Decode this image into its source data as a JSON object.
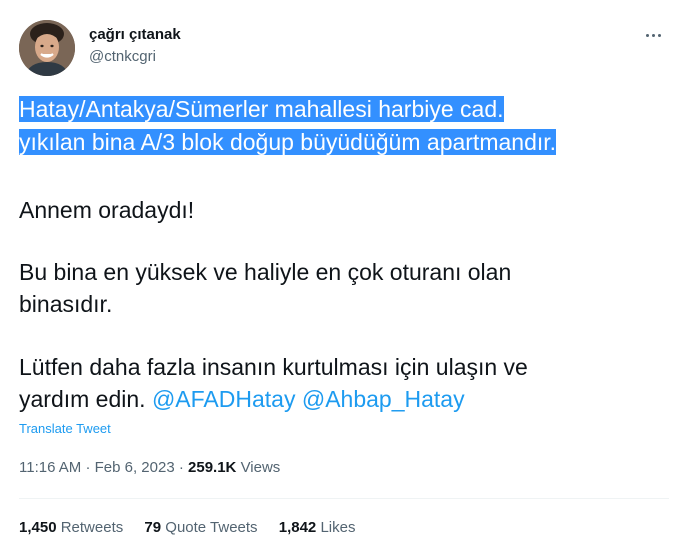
{
  "author": {
    "display_name": "çağrı çıtanak",
    "handle": "@ctnkcgri"
  },
  "tweet": {
    "highlighted_lines": [
      "Hatay/Antakya/Sümerler mahallesi harbiye cad.",
      "yıkılan bina A/3 blok doğup büyüdüğüm apartmandır."
    ],
    "paragraph_2": "Annem oradaydı!",
    "paragraph_3_lines": [
      "Bu bina en yüksek ve haliyle en çok oturanı olan",
      "binasıdır."
    ],
    "paragraph_4_line_1": "Lütfen daha fazla insanın kurtulması için ulaşın ve",
    "paragraph_4_line_2_prefix": "yardım edin.",
    "mentions": [
      "@AFADHatay",
      "@Ahbap_Hatay"
    ]
  },
  "translate_label": "Translate Tweet",
  "meta": {
    "time": "11:16 AM",
    "date": "Feb 6, 2023",
    "separator": "·",
    "views_count": "259.1K",
    "views_label": "Views"
  },
  "stats": {
    "retweets_count": "1,450",
    "retweets_label": "Retweets",
    "quote_count": "79",
    "quote_label": "Quote Tweets",
    "likes_count": "1,842",
    "likes_label": "Likes"
  },
  "icons": {
    "more": "more-horizontal-icon"
  },
  "colors": {
    "text": "#0f1419",
    "secondary": "#536471",
    "link": "#1d9bf0",
    "selection": "#3390ff",
    "divider": "#eff3f4"
  }
}
